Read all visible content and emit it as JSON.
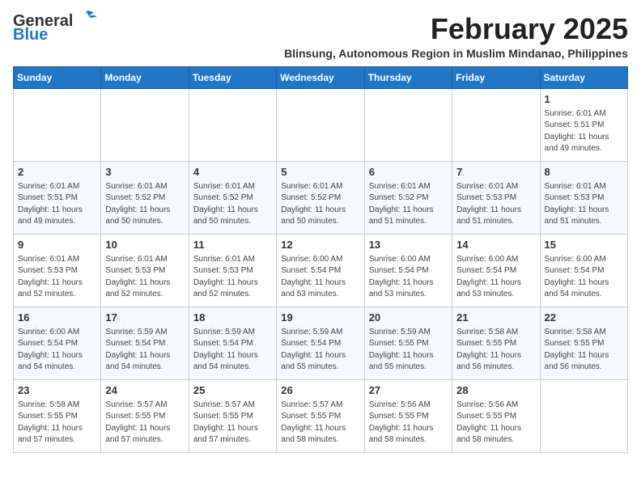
{
  "header": {
    "logo_line1": "General",
    "logo_line2": "Blue",
    "month_title": "February 2025",
    "subtitle": "Blinsung, Autonomous Region in Muslim Mindanao, Philippines"
  },
  "days_of_week": [
    "Sunday",
    "Monday",
    "Tuesday",
    "Wednesday",
    "Thursday",
    "Friday",
    "Saturday"
  ],
  "weeks": [
    [
      {
        "day": "",
        "info": ""
      },
      {
        "day": "",
        "info": ""
      },
      {
        "day": "",
        "info": ""
      },
      {
        "day": "",
        "info": ""
      },
      {
        "day": "",
        "info": ""
      },
      {
        "day": "",
        "info": ""
      },
      {
        "day": "1",
        "info": "Sunrise: 6:01 AM\nSunset: 5:51 PM\nDaylight: 11 hours\nand 49 minutes."
      }
    ],
    [
      {
        "day": "2",
        "info": "Sunrise: 6:01 AM\nSunset: 5:51 PM\nDaylight: 11 hours\nand 49 minutes."
      },
      {
        "day": "3",
        "info": "Sunrise: 6:01 AM\nSunset: 5:52 PM\nDaylight: 11 hours\nand 50 minutes."
      },
      {
        "day": "4",
        "info": "Sunrise: 6:01 AM\nSunset: 5:52 PM\nDaylight: 11 hours\nand 50 minutes."
      },
      {
        "day": "5",
        "info": "Sunrise: 6:01 AM\nSunset: 5:52 PM\nDaylight: 11 hours\nand 50 minutes."
      },
      {
        "day": "6",
        "info": "Sunrise: 6:01 AM\nSunset: 5:52 PM\nDaylight: 11 hours\nand 51 minutes."
      },
      {
        "day": "7",
        "info": "Sunrise: 6:01 AM\nSunset: 5:53 PM\nDaylight: 11 hours\nand 51 minutes."
      },
      {
        "day": "8",
        "info": "Sunrise: 6:01 AM\nSunset: 5:53 PM\nDaylight: 11 hours\nand 51 minutes."
      }
    ],
    [
      {
        "day": "9",
        "info": "Sunrise: 6:01 AM\nSunset: 5:53 PM\nDaylight: 11 hours\nand 52 minutes."
      },
      {
        "day": "10",
        "info": "Sunrise: 6:01 AM\nSunset: 5:53 PM\nDaylight: 11 hours\nand 52 minutes."
      },
      {
        "day": "11",
        "info": "Sunrise: 6:01 AM\nSunset: 5:53 PM\nDaylight: 11 hours\nand 52 minutes."
      },
      {
        "day": "12",
        "info": "Sunrise: 6:00 AM\nSunset: 5:54 PM\nDaylight: 11 hours\nand 53 minutes."
      },
      {
        "day": "13",
        "info": "Sunrise: 6:00 AM\nSunset: 5:54 PM\nDaylight: 11 hours\nand 53 minutes."
      },
      {
        "day": "14",
        "info": "Sunrise: 6:00 AM\nSunset: 5:54 PM\nDaylight: 11 hours\nand 53 minutes."
      },
      {
        "day": "15",
        "info": "Sunrise: 6:00 AM\nSunset: 5:54 PM\nDaylight: 11 hours\nand 54 minutes."
      }
    ],
    [
      {
        "day": "16",
        "info": "Sunrise: 6:00 AM\nSunset: 5:54 PM\nDaylight: 11 hours\nand 54 minutes."
      },
      {
        "day": "17",
        "info": "Sunrise: 5:59 AM\nSunset: 5:54 PM\nDaylight: 11 hours\nand 54 minutes."
      },
      {
        "day": "18",
        "info": "Sunrise: 5:59 AM\nSunset: 5:54 PM\nDaylight: 11 hours\nand 54 minutes."
      },
      {
        "day": "19",
        "info": "Sunrise: 5:59 AM\nSunset: 5:54 PM\nDaylight: 11 hours\nand 55 minutes."
      },
      {
        "day": "20",
        "info": "Sunrise: 5:59 AM\nSunset: 5:55 PM\nDaylight: 11 hours\nand 55 minutes."
      },
      {
        "day": "21",
        "info": "Sunrise: 5:58 AM\nSunset: 5:55 PM\nDaylight: 11 hours\nand 56 minutes."
      },
      {
        "day": "22",
        "info": "Sunrise: 5:58 AM\nSunset: 5:55 PM\nDaylight: 11 hours\nand 56 minutes."
      }
    ],
    [
      {
        "day": "23",
        "info": "Sunrise: 5:58 AM\nSunset: 5:55 PM\nDaylight: 11 hours\nand 57 minutes."
      },
      {
        "day": "24",
        "info": "Sunrise: 5:57 AM\nSunset: 5:55 PM\nDaylight: 11 hours\nand 57 minutes."
      },
      {
        "day": "25",
        "info": "Sunrise: 5:57 AM\nSunset: 5:55 PM\nDaylight: 11 hours\nand 57 minutes."
      },
      {
        "day": "26",
        "info": "Sunrise: 5:57 AM\nSunset: 5:55 PM\nDaylight: 11 hours\nand 58 minutes."
      },
      {
        "day": "27",
        "info": "Sunrise: 5:56 AM\nSunset: 5:55 PM\nDaylight: 11 hours\nand 58 minutes."
      },
      {
        "day": "28",
        "info": "Sunrise: 5:56 AM\nSunset: 5:55 PM\nDaylight: 11 hours\nand 58 minutes."
      },
      {
        "day": "",
        "info": ""
      }
    ]
  ]
}
